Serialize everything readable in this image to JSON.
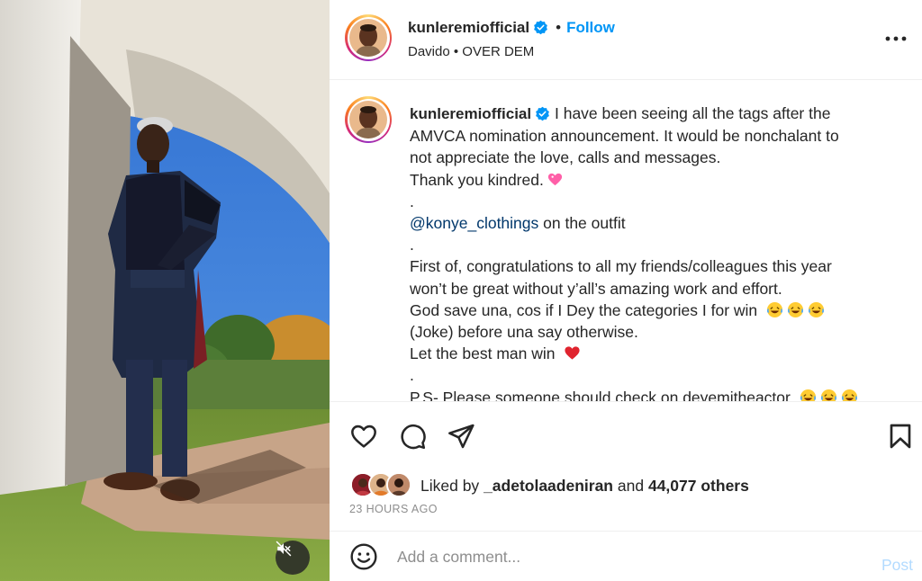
{
  "media": {
    "type": "video",
    "mute_icon": "muted-speaker-icon"
  },
  "post": {
    "author": {
      "username": "kunleremiofficial",
      "verified": true
    },
    "follow_label": "Follow",
    "music": {
      "artist": "Davido",
      "track": "OVER DEM"
    },
    "caption": {
      "username": "kunleremiofficial",
      "line1": "I have been seeing all the tags after the",
      "line2": "AMVCA nomination announcement. It would be nonchalant to",
      "line3": "not appreciate the love, calls and messages.",
      "line4": "Thank you kindred.",
      "dot1": ".",
      "mention": "@konye_clothings",
      "mention_suffix": " on the outfit",
      "dot2": ".",
      "line7": "First of, congratulations to all my friends/colleagues this year",
      "line8": "won’t be great without y’all’s amazing work and effort.",
      "line9": "God save una, cos if I Dey the categories I for win",
      "line10": "(Joke) before una say otherwise.",
      "line11": "Let the best man win",
      "dot3": ".",
      "line13": "P.S- Please someone should check on deyemitheactor"
    },
    "likes": {
      "prefix": "Liked by",
      "user": "_adetolaadeniran",
      "conjunction": "and",
      "others": "44,077 others"
    },
    "timestamp": "23 HOURS AGO",
    "comment": {
      "placeholder": "Add a comment...",
      "post_label": "Post"
    }
  },
  "icons": {
    "heart": "heart-icon",
    "comment": "comment-icon",
    "share": "share-icon",
    "save": "bookmark-icon",
    "more": "more-options-icon",
    "emoji": "emoji-icon"
  },
  "colors": {
    "link": "#0095f6",
    "mention": "#00376b",
    "verified": "#0095f6",
    "muted_text": "#8e8e8e",
    "post_disabled": "#b3dbff"
  }
}
